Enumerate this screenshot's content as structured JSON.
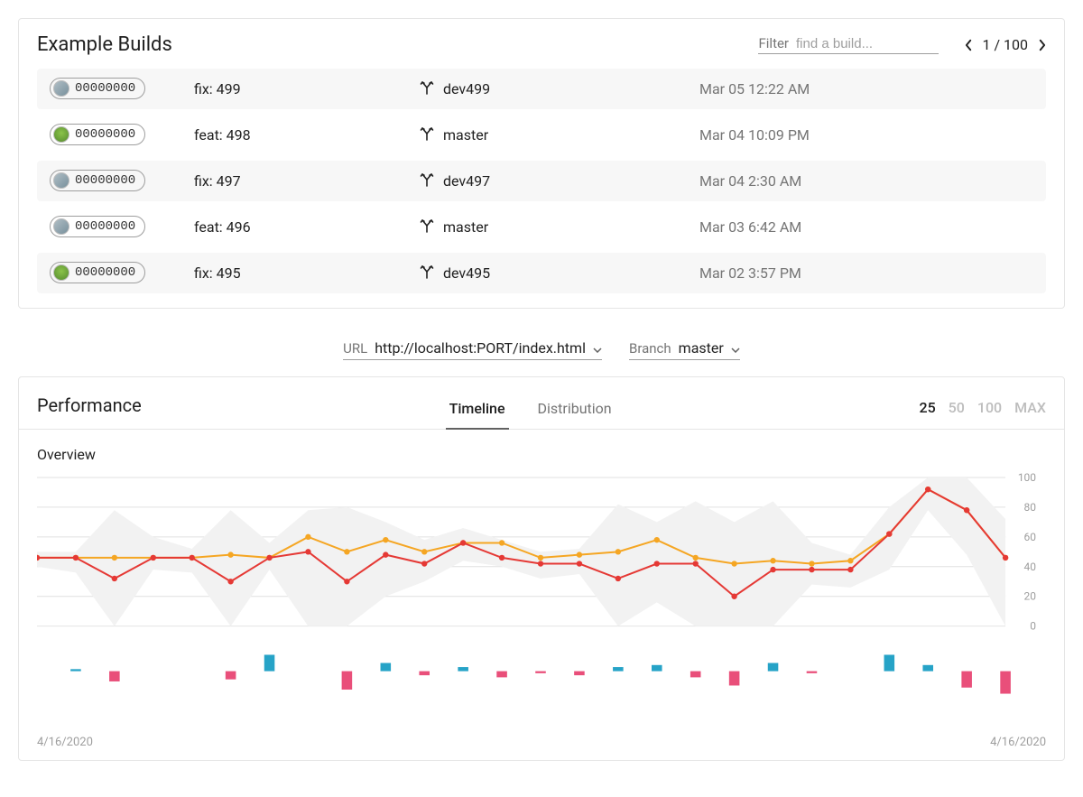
{
  "builds_panel": {
    "title": "Example Builds",
    "filter_label": "Filter",
    "filter_placeholder": "find a build...",
    "pager_text": "1 / 100",
    "rows": [
      {
        "hash": "00000000",
        "message": "fix: 499",
        "branch": "dev499",
        "time": "Mar 05 12:22 AM",
        "avatar": "grey"
      },
      {
        "hash": "00000000",
        "message": "feat: 498",
        "branch": "master",
        "time": "Mar 04 10:09 PM",
        "avatar": "green"
      },
      {
        "hash": "00000000",
        "message": "fix: 497",
        "branch": "dev497",
        "time": "Mar 04 2:30 AM",
        "avatar": "grey"
      },
      {
        "hash": "00000000",
        "message": "feat: 496",
        "branch": "master",
        "time": "Mar 03 6:42 AM",
        "avatar": "grey"
      },
      {
        "hash": "00000000",
        "message": "fix: 495",
        "branch": "dev495",
        "time": "Mar 02 3:57 PM",
        "avatar": "green"
      }
    ]
  },
  "filters": {
    "url_label": "URL",
    "url_value": "http://localhost:PORT/index.html",
    "branch_label": "Branch",
    "branch_value": "master"
  },
  "perf_panel": {
    "title": "Performance",
    "tabs": [
      "Timeline",
      "Distribution"
    ],
    "active_tab": "Timeline",
    "range_options": [
      "25",
      "50",
      "100",
      "MAX"
    ],
    "active_range": "25",
    "overview_label": "Overview",
    "date_start": "4/16/2020",
    "date_end": "4/16/2020"
  },
  "chart_data": {
    "type": "line",
    "title": "Overview",
    "ylabel": "",
    "xlabel": "",
    "ylim": [
      0,
      100
    ],
    "yticks": [
      0,
      20,
      40,
      60,
      80,
      100
    ],
    "x_range_labels": [
      "4/16/2020",
      "4/16/2020"
    ],
    "n_points": 25,
    "series": [
      {
        "name": "orange",
        "color": "#f5a623",
        "values": [
          46,
          46,
          46,
          46,
          46,
          48,
          46,
          60,
          50,
          58,
          50,
          56,
          56,
          46,
          48,
          50,
          58,
          46,
          42,
          44,
          42,
          44,
          62,
          92,
          78,
          46
        ]
      },
      {
        "name": "red",
        "color": "#e53935",
        "values": [
          46,
          46,
          32,
          46,
          46,
          30,
          46,
          50,
          30,
          48,
          42,
          56,
          46,
          42,
          42,
          32,
          42,
          42,
          20,
          38,
          38,
          38,
          62,
          92,
          78,
          46
        ]
      }
    ],
    "band": {
      "upper": [
        50,
        50,
        78,
        60,
        52,
        78,
        56,
        78,
        80,
        70,
        58,
        66,
        58,
        50,
        52,
        82,
        70,
        84,
        70,
        84,
        56,
        48,
        80,
        100,
        100,
        72
      ],
      "lower": [
        40,
        36,
        0,
        38,
        36,
        0,
        38,
        0,
        0,
        20,
        30,
        44,
        40,
        32,
        35,
        0,
        16,
        0,
        0,
        0,
        28,
        26,
        38,
        78,
        48,
        0
      ]
    },
    "delta_bars": {
      "positive_color": "#26a3c7",
      "negative_color": "#e94f7a",
      "values": [
        0,
        2,
        -10,
        0,
        0,
        -8,
        16,
        0,
        -18,
        8,
        -4,
        4,
        -6,
        -2,
        -4,
        4,
        6,
        -6,
        -14,
        8,
        -2,
        0,
        16,
        6,
        -16,
        -22
      ]
    }
  }
}
